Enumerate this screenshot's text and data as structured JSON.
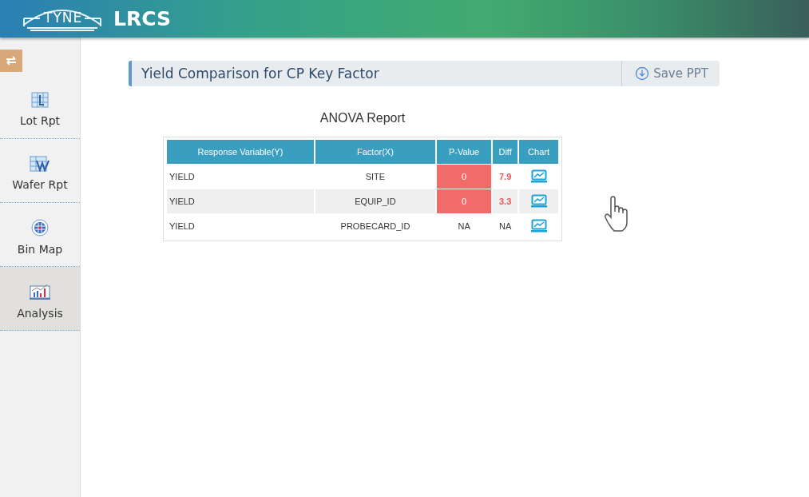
{
  "header": {
    "logo_text": "TYNE",
    "app_name": "LRCS"
  },
  "sidebar": {
    "items": [
      {
        "kind": "lot",
        "label": "Lot Rpt",
        "selected": false
      },
      {
        "kind": "wafer",
        "label": "Wafer Rpt",
        "selected": false
      },
      {
        "kind": "binmap",
        "label": "Bin Map",
        "selected": false
      },
      {
        "kind": "analysis",
        "label": "Analysis",
        "selected": true
      }
    ]
  },
  "panel": {
    "title": "Yield Comparison for CP Key Factor",
    "save_button": "Save PPT"
  },
  "report": {
    "title": "ANOVA Report",
    "columns": [
      "Response Variable(Y)",
      "Factor(X)",
      "P-Value",
      "Diff",
      "Chart"
    ],
    "rows": [
      {
        "response": "YIELD",
        "factor": "SITE",
        "p_value": "0",
        "diff": "7.9",
        "significant": true
      },
      {
        "response": "YIELD",
        "factor": "EQUIP_ID",
        "p_value": "0",
        "diff": "3.3",
        "significant": true
      },
      {
        "response": "YIELD",
        "factor": "PROBECARD_ID",
        "p_value": "NA",
        "diff": "NA",
        "significant": false
      }
    ]
  }
}
